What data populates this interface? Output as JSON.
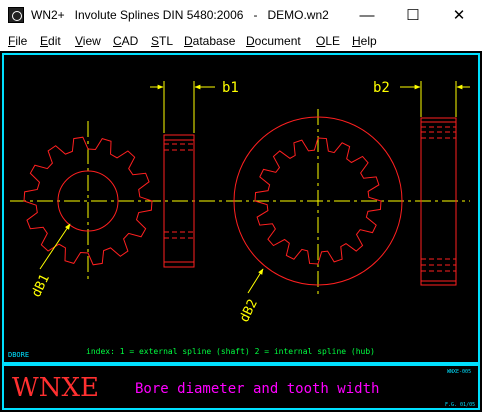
{
  "window": {
    "title": "WN2+   Involute Splines DIN 5480:2006   -   DEMO.wn2",
    "minimize_glyph": "—",
    "maximize_glyph": "☐",
    "close_glyph": "✕"
  },
  "menu": {
    "items": [
      {
        "acc": "F",
        "rest": "ile"
      },
      {
        "acc": "E",
        "rest": "dit"
      },
      {
        "acc": "V",
        "rest": "iew"
      },
      {
        "acc": "C",
        "rest": "AD"
      },
      {
        "acc": "S",
        "rest": "TL"
      },
      {
        "acc": "D",
        "rest": "atabase"
      },
      {
        "acc": "D",
        "rest": "ocument"
      },
      {
        "acc": "O",
        "rest": "LE"
      },
      {
        "acc": "H",
        "rest": "elp"
      }
    ]
  },
  "drawing": {
    "label_b1": "b1",
    "label_b2": "b2",
    "label_dB1": "dB1",
    "label_dB2": "dB2",
    "corner_label": "DBORE",
    "index_text": "index:   1 = external spline (shaft)    2 = internal spline (hub)",
    "logo": "WNXE",
    "caption": "Bore diameter and tooth width",
    "ref_top": "WNXE-005",
    "ref_bottom": "F.G. 01/05"
  },
  "colors": {
    "frame": "#00e0ff",
    "dim": "#ffff00",
    "part": "#ff2020",
    "center": "#ffff00",
    "text_green": "#00ff40",
    "text_magenta": "#ff00ff",
    "text_white": "#ffffff",
    "logo_red": "#ff3030"
  }
}
